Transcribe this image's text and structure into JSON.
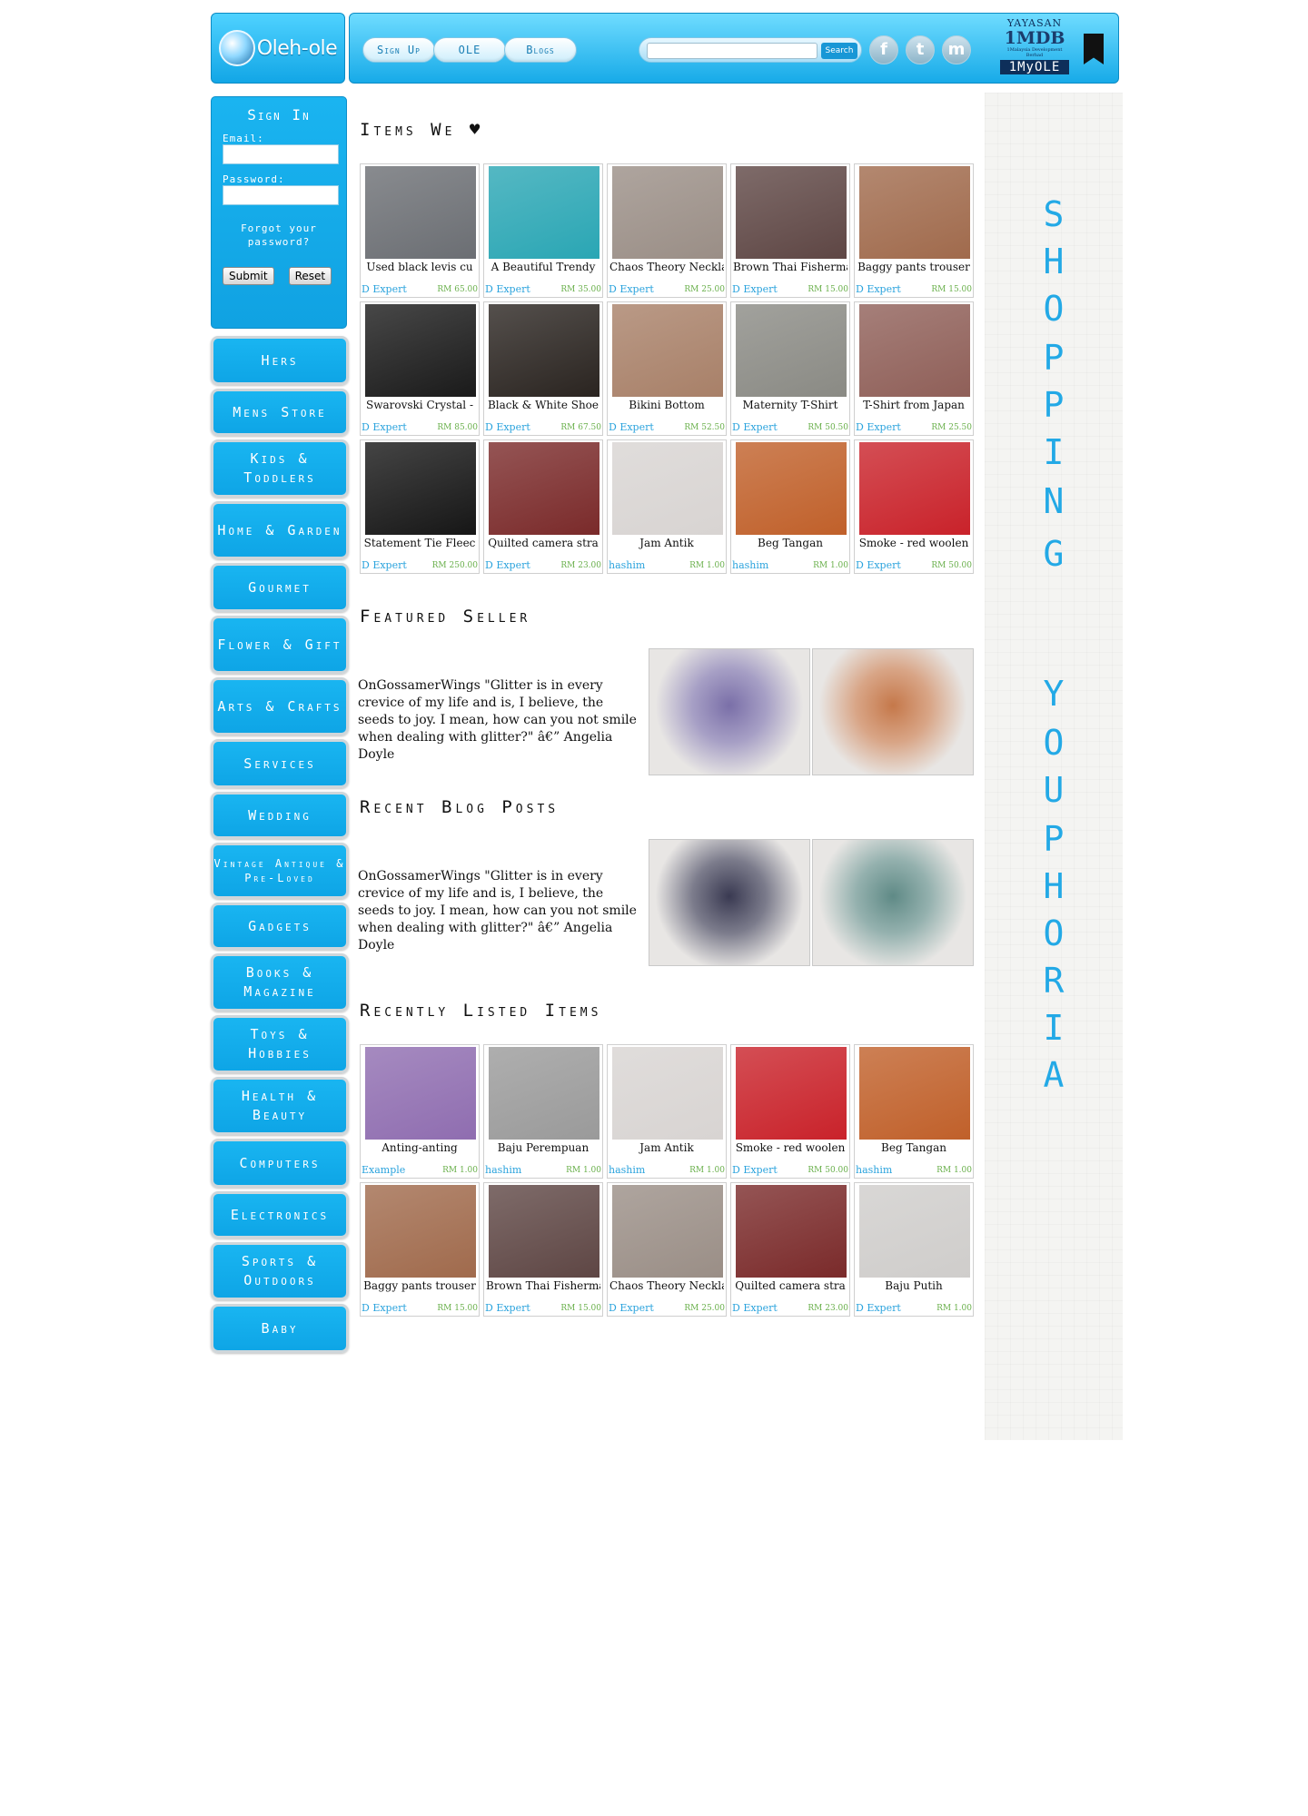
{
  "header": {
    "logo_text": "Oleh-ole",
    "nav": [
      "Sign Up",
      "OLE",
      "Blogs"
    ],
    "search_button": "Search",
    "social_icons": [
      "facebook-icon",
      "twitter-icon",
      "myspace-icon"
    ],
    "sponsor": {
      "line1": "YAYASAN",
      "line2": "1MDB",
      "line3": "1Malaysia Development Berhad",
      "line4": "1MyOLE"
    }
  },
  "signin": {
    "title": "Sign In",
    "email_label": "Email:",
    "password_label": "Password:",
    "forgot": "Forgot your password?",
    "submit": "Submit",
    "reset": "Reset"
  },
  "categories": [
    "Hers",
    "Mens Store",
    "Kids & Toddlers",
    "Home & Garden",
    "Gourmet",
    "Flower & Gift",
    "Arts & Crafts",
    "Services",
    "Wedding",
    "Vintage Antique & Pre-Loved",
    "Gadgets",
    "Books & Magazine",
    "Toys & Hobbies",
    "Health & Beauty",
    "Computers",
    "Electronics",
    "Sports & Outdoors",
    "Baby"
  ],
  "sections": {
    "items_we_love": "Items We ♥",
    "featured_seller": "Featured Seller",
    "recent_blog": "Recent Blog Posts",
    "recently_listed": "Recently Listed Items"
  },
  "items_we_love": [
    {
      "name": "Used black levis cu",
      "seller": "D Expert",
      "price": "RM 65.00",
      "color": "#6b6e73"
    },
    {
      "name": "A Beautiful Trendy",
      "seller": "D Expert",
      "price": "RM 35.00",
      "color": "#2aa6b4"
    },
    {
      "name": "Chaos Theory Neckla",
      "seller": "D Expert",
      "price": "RM 25.00",
      "color": "#9a8e86"
    },
    {
      "name": "Brown Thai Fisherma",
      "seller": "D Expert",
      "price": "RM 15.00",
      "color": "#5e4644"
    },
    {
      "name": "Baggy pants trouser",
      "seller": "D Expert",
      "price": "RM 15.00",
      "color": "#a06a4c"
    },
    {
      "name": "Swarovski Crystal -",
      "seller": "D Expert",
      "price": "RM 85.00",
      "color": "#1a1a1a"
    },
    {
      "name": "Black & White Shoe",
      "seller": "D Expert",
      "price": "RM 67.50",
      "color": "#2a2420"
    },
    {
      "name": "Bikini Bottom",
      "seller": "D Expert",
      "price": "RM 52.50",
      "color": "#a88068"
    },
    {
      "name": "Maternity T-Shirt",
      "seller": "D Expert",
      "price": "RM 50.50",
      "color": "#8a8a84"
    },
    {
      "name": "T-Shirt from Japan",
      "seller": "D Expert",
      "price": "RM 25.50",
      "color": "#8f5f58"
    },
    {
      "name": "Statement Tie Fleec",
      "seller": "D Expert",
      "price": "RM 250.00",
      "color": "#161616"
    },
    {
      "name": "Quilted camera stra",
      "seller": "D Expert",
      "price": "RM 23.00",
      "color": "#7a2a2a"
    },
    {
      "name": "Jam Antik",
      "seller": "hashim",
      "price": "RM 1.00",
      "color": "#d8d4d2"
    },
    {
      "name": "Beg Tangan",
      "seller": "hashim",
      "price": "RM 1.00",
      "color": "#c0602a"
    },
    {
      "name": "Smoke - red woolen",
      "seller": "D Expert",
      "price": "RM 50.00",
      "color": "#c9222a"
    }
  ],
  "featured_seller": {
    "text": "OnGossamerWings \"Glitter is in every crevice of my life and is, I believe, the seeds to joy. I mean, how can you not smile when dealing with glitter?\" â€” Angelia Doyle",
    "images": [
      "#7a6fa8",
      "#c5784a"
    ]
  },
  "recent_blog": {
    "text": "OnGossamerWings \"Glitter is in every crevice of my life and is, I believe, the seeds to joy. I mean, how can you not smile when dealing with glitter?\" â€” Angelia Doyle",
    "images": [
      "#3a3a52",
      "#5f8a86"
    ]
  },
  "recently_listed": [
    {
      "name": "Anting-anting",
      "seller": "Example",
      "price": "RM 1.00",
      "color": "#8f6db0"
    },
    {
      "name": "Baju Perempuan",
      "seller": "hashim",
      "price": "RM 1.00",
      "color": "#9a9a9a"
    },
    {
      "name": "Jam Antik",
      "seller": "hashim",
      "price": "RM 1.00",
      "color": "#d8d4d2"
    },
    {
      "name": "Smoke - red woolen",
      "seller": "D Expert",
      "price": "RM 50.00",
      "color": "#c9222a"
    },
    {
      "name": "Beg Tangan",
      "seller": "hashim",
      "price": "RM 1.00",
      "color": "#c0602a"
    },
    {
      "name": "Baggy pants trouser",
      "seller": "D Expert",
      "price": "RM 15.00",
      "color": "#a06a4c"
    },
    {
      "name": "Brown Thai Fisherma",
      "seller": "D Expert",
      "price": "RM 15.00",
      "color": "#5e4644"
    },
    {
      "name": "Chaos Theory Neckla",
      "seller": "D Expert",
      "price": "RM 25.00",
      "color": "#9a8e86"
    },
    {
      "name": "Quilted camera stra",
      "seller": "D Expert",
      "price": "RM 23.00",
      "color": "#7a2a2a"
    },
    {
      "name": "Baju Putih",
      "seller": "D Expert",
      "price": "RM 1.00",
      "color": "#cfcdcb"
    }
  ],
  "banner": {
    "word1": "SHOPPING",
    "word2": "YOUPHORIA",
    "color": "#23a9e6"
  }
}
